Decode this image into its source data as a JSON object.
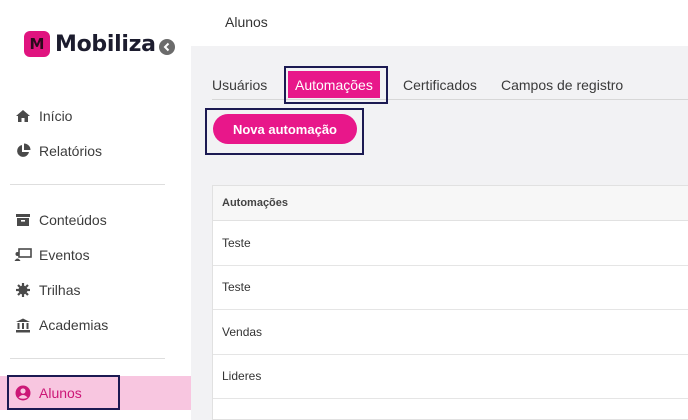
{
  "brand": {
    "name": "Mobiliza",
    "mark": "M",
    "accent": "#e8178a"
  },
  "sidebar": {
    "items": [
      {
        "label": "Início",
        "icon": "home-icon"
      },
      {
        "label": "Relatórios",
        "icon": "pie-chart-icon"
      },
      {
        "label": "Conteúdos",
        "icon": "archive-icon"
      },
      {
        "label": "Eventos",
        "icon": "presentation-icon"
      },
      {
        "label": "Trilhas",
        "icon": "gear-icon"
      },
      {
        "label": "Academias",
        "icon": "institution-icon"
      },
      {
        "label": "Alunos",
        "icon": "user-circle-icon",
        "active": true
      }
    ]
  },
  "header": {
    "title": "Alunos"
  },
  "tabs": [
    {
      "label": "Usuários"
    },
    {
      "label": "Automações",
      "active": true
    },
    {
      "label": "Certificados"
    },
    {
      "label": "Campos de registro"
    }
  ],
  "actions": {
    "new_automation": "Nova automação"
  },
  "table": {
    "header": "Automações",
    "rows": [
      "Teste",
      "Teste",
      "Vendas",
      "Lideres"
    ]
  }
}
